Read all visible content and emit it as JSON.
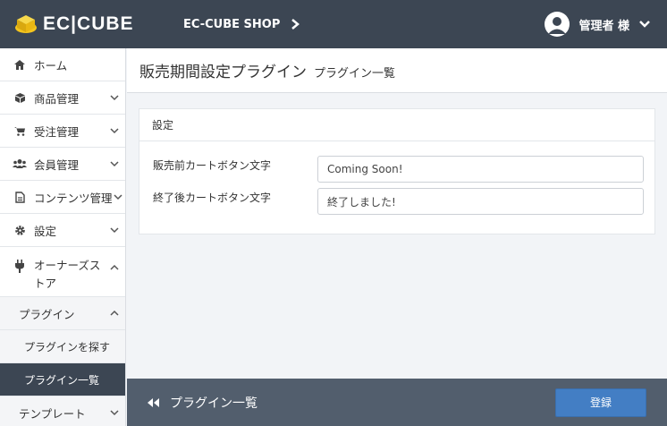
{
  "header": {
    "logo_text": "EC|CUBE",
    "shop_name": "EC-CUBE SHOP",
    "user_name": "管理者 様"
  },
  "sidebar": {
    "items": [
      {
        "label": "ホーム",
        "icon": "home-icon"
      },
      {
        "label": "商品管理",
        "icon": "cube-icon"
      },
      {
        "label": "受注管理",
        "icon": "cart-icon"
      },
      {
        "label": "会員管理",
        "icon": "users-icon"
      },
      {
        "label": "コンテンツ管理",
        "icon": "document-icon"
      },
      {
        "label": "設定",
        "icon": "gear-icon"
      },
      {
        "label": "オーナーズストア",
        "icon": "plug-icon"
      },
      {
        "label": "プラグイン"
      },
      {
        "label": "プラグインを探す"
      },
      {
        "label": "プラグイン一覧"
      },
      {
        "label": "テンプレート"
      }
    ]
  },
  "page": {
    "title": "販売期間設定プラグイン",
    "subtitle": "プラグイン一覧"
  },
  "card": {
    "heading": "設定",
    "fields": [
      {
        "label": "販売前カートボタン文字",
        "value": "Coming Soon!"
      },
      {
        "label": "終了後カートボタン文字",
        "value": "終了しました!"
      }
    ]
  },
  "footer": {
    "back_label": "プラグイン一覧",
    "register_label": "登録"
  },
  "colors": {
    "header_bg": "#3c4653",
    "footer_bg": "#525e6d",
    "primary": "#437ec4",
    "logo_yellow": "#f5c51d"
  }
}
